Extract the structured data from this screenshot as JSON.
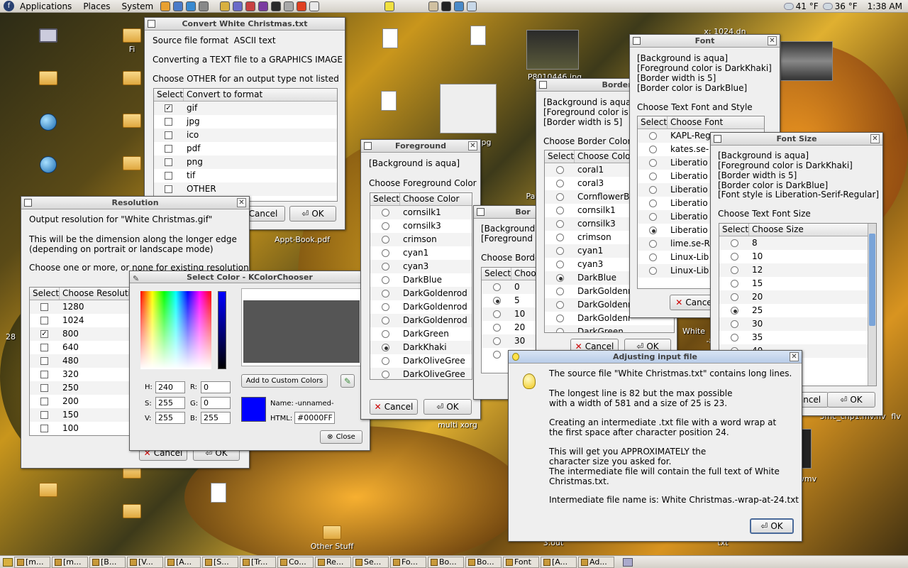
{
  "top_panel": {
    "menus": [
      "Applications",
      "Places",
      "System"
    ],
    "weather": "41 °F",
    "weather2": "36 °F",
    "clock": "1:38 AM"
  },
  "desktop": {
    "icons": [
      "Appt-Book.pdf",
      "P8010446.jpg",
      "Other Stuff",
      "x: 1024.dn",
      "3.out",
      "White",
      "multi xorg",
      "Pa",
      "txt",
      "wmv",
      "3mc_cnp1.mv.flv",
      "flv",
      "-8",
      "ipg",
      "28",
      "Fi"
    ]
  },
  "convert": {
    "title": "Convert White Christmas.txt",
    "line1": "Source file format  ASCII text",
    "line2": "Converting a TEXT file to a GRAPHICS IMAGE",
    "line3": "Choose OTHER for an output type not listed",
    "col1": "Select",
    "col2": "Convert to format",
    "rows": [
      {
        "label": "gif",
        "checked": true
      },
      {
        "label": "jpg",
        "checked": false
      },
      {
        "label": "ico",
        "checked": false
      },
      {
        "label": "pdf",
        "checked": false
      },
      {
        "label": "png",
        "checked": false
      },
      {
        "label": "tif",
        "checked": false
      },
      {
        "label": "OTHER",
        "checked": false
      }
    ],
    "cancel": "Cancel",
    "ok": "OK"
  },
  "resolution": {
    "title": "Resolution",
    "line1": "Output resolution for \"White Christmas.gif\"",
    "line2": "This will be the dimension along the longer edge\n(depending on portrait or landscape mode)",
    "line3": "Choose one or more, or none for existing resolution",
    "col1": "Select",
    "col2": "Choose Resolution",
    "rows": [
      {
        "label": "1280",
        "checked": false
      },
      {
        "label": "1024",
        "checked": false
      },
      {
        "label": "800",
        "checked": true
      },
      {
        "label": "640",
        "checked": false
      },
      {
        "label": "480",
        "checked": false
      },
      {
        "label": "320",
        "checked": false
      },
      {
        "label": "250",
        "checked": false
      },
      {
        "label": "200",
        "checked": false
      },
      {
        "label": "150",
        "checked": false
      },
      {
        "label": "100",
        "checked": false
      }
    ],
    "cancel": "Cancel",
    "ok": "OK"
  },
  "kcolor": {
    "title": "Select Color - KColorChooser",
    "add_custom": "Add to Custom Colors",
    "h_label": "H:",
    "h": "240",
    "s_label": "S:",
    "s": "255",
    "v_label": "V:",
    "v": "255",
    "r_label": "R:",
    "r": "0",
    "g_label": "G:",
    "g": "0",
    "b_label": "B:",
    "b": "255",
    "name_label": "Name:",
    "name": "-unnamed-",
    "html_label": "HTML:",
    "html": "#0000FF",
    "close": "Close",
    "swatch": "#0000FF"
  },
  "foreground": {
    "title": "Foreground",
    "line1": "[Background is aqua]",
    "line2": "Choose Foreground Color",
    "col1": "Select",
    "col2": "Choose Color",
    "rows": [
      {
        "label": "cornsilk1",
        "on": false
      },
      {
        "label": "cornsilk3",
        "on": false
      },
      {
        "label": "crimson",
        "on": false
      },
      {
        "label": "cyan1",
        "on": false
      },
      {
        "label": "cyan3",
        "on": false
      },
      {
        "label": "DarkBlue",
        "on": false
      },
      {
        "label": "DarkGoldenrod",
        "on": false
      },
      {
        "label": "DarkGoldenrod",
        "on": false
      },
      {
        "label": "DarkGoldenrod",
        "on": false
      },
      {
        "label": "DarkGreen",
        "on": false
      },
      {
        "label": "DarkKhaki",
        "on": true
      },
      {
        "label": "DarkOliveGree",
        "on": false
      },
      {
        "label": "DarkOliveGree",
        "on": false
      },
      {
        "label": "DarkOliveGree",
        "on": false
      }
    ],
    "cancel": "Cancel",
    "ok": "OK"
  },
  "border_width": {
    "title": "Bor",
    "line1": "[Background",
    "line2": "[Foreground",
    "line3": "Choose Borde",
    "col1": "Select",
    "col2": "Choo",
    "rows": [
      {
        "label": "0",
        "on": false
      },
      {
        "label": "5",
        "on": true
      },
      {
        "label": "10",
        "on": false
      },
      {
        "label": "20",
        "on": false
      },
      {
        "label": "30",
        "on": false
      },
      {
        "label": "",
        "on": false
      }
    ]
  },
  "border_color": {
    "title": "Border Colo",
    "line1": "[Background is aqua]",
    "line2": "[Foreground color is",
    "line3": "[Border width is 5]",
    "line4": "Choose Border Color",
    "col1": "Select",
    "col2": "Choose Colo",
    "rows": [
      {
        "label": "coral1",
        "on": false
      },
      {
        "label": "coral3",
        "on": false
      },
      {
        "label": "CornflowerBl",
        "on": false
      },
      {
        "label": "cornsilk1",
        "on": false
      },
      {
        "label": "cornsilk3",
        "on": false
      },
      {
        "label": "crimson",
        "on": false
      },
      {
        "label": "cyan1",
        "on": false
      },
      {
        "label": "cyan3",
        "on": false
      },
      {
        "label": "DarkBlue",
        "on": true
      },
      {
        "label": "DarkGoldenr",
        "on": false
      },
      {
        "label": "DarkGoldenr",
        "on": false
      },
      {
        "label": "DarkGoldenr",
        "on": false
      },
      {
        "label": "DarkGreen",
        "on": false
      }
    ],
    "cancel": "Cancel",
    "ok": "OK"
  },
  "font": {
    "title": "Font",
    "line1": "[Background is aqua]",
    "line2": "[Foreground color is DarkKhaki]",
    "line3": "[Border width is 5]",
    "line4": "[Border color is DarkBlue]",
    "line5": "Choose Text Font and Style",
    "col1": "Select",
    "col2": "Choose Font",
    "rows": [
      {
        "label": "KAPL-Reg",
        "on": false
      },
      {
        "label": "kates.se-",
        "on": false
      },
      {
        "label": "Liberatio",
        "on": false
      },
      {
        "label": "Liberatio",
        "on": false
      },
      {
        "label": "Liberatio",
        "on": false
      },
      {
        "label": "Liberatio",
        "on": false
      },
      {
        "label": "Liberatio",
        "on": false
      },
      {
        "label": "Liberatio",
        "on": true
      },
      {
        "label": "lime.se-R",
        "on": false
      },
      {
        "label": "Linux-Lib",
        "on": false
      },
      {
        "label": "Linux-Lib",
        "on": false
      }
    ],
    "cancel": "Cance"
  },
  "font_size": {
    "title": "Font Size",
    "line1": "[Background is aqua]",
    "line2": "[Foreground color is DarkKhaki]",
    "line3": "[Border width is 5]",
    "line4": "[Border color is DarkBlue]",
    "line5": "[Font style is Liberation-Serif-Regular]",
    "line6": "Choose Text Font Size",
    "col1": "Select",
    "col2": "Choose Size",
    "rows": [
      {
        "label": "8",
        "on": false
      },
      {
        "label": "10",
        "on": false
      },
      {
        "label": "12",
        "on": false
      },
      {
        "label": "15",
        "on": false
      },
      {
        "label": "20",
        "on": false
      },
      {
        "label": "25",
        "on": true
      },
      {
        "label": "30",
        "on": false
      },
      {
        "label": "35",
        "on": false
      },
      {
        "label": "40",
        "on": false
      }
    ],
    "cancel": "ancel",
    "ok": "OK"
  },
  "adjusting": {
    "title": "Adjusting input file",
    "p1": "The source file \"White Christmas.txt\" contains long lines.",
    "p2": "The longest line is 82 but the max possible\nwith a width of 581 and a size of 25 is 23.",
    "p3": "Creating an intermediate .txt file with a word wrap at\nthe first space after character position 24.",
    "p4": "This will get you APPROXIMATELY the\ncharacter size you asked for.\nThe intermediate file will contain the full text of White\nChristmas.txt.",
    "p5": "Intermediate file name is: White Christmas.-wrap-at-24.txt",
    "ok": "OK"
  },
  "taskbar": [
    {
      "label": "[m..."
    },
    {
      "label": "[m..."
    },
    {
      "label": "[B..."
    },
    {
      "label": "[V..."
    },
    {
      "label": "[A..."
    },
    {
      "label": "[S..."
    },
    {
      "label": "[Tr..."
    },
    {
      "label": "Co..."
    },
    {
      "label": "Re..."
    },
    {
      "label": "Se..."
    },
    {
      "label": "Fo..."
    },
    {
      "label": "Bo..."
    },
    {
      "label": "Bo..."
    },
    {
      "label": "Font"
    },
    {
      "label": "[A..."
    },
    {
      "label": "Ad..."
    }
  ]
}
